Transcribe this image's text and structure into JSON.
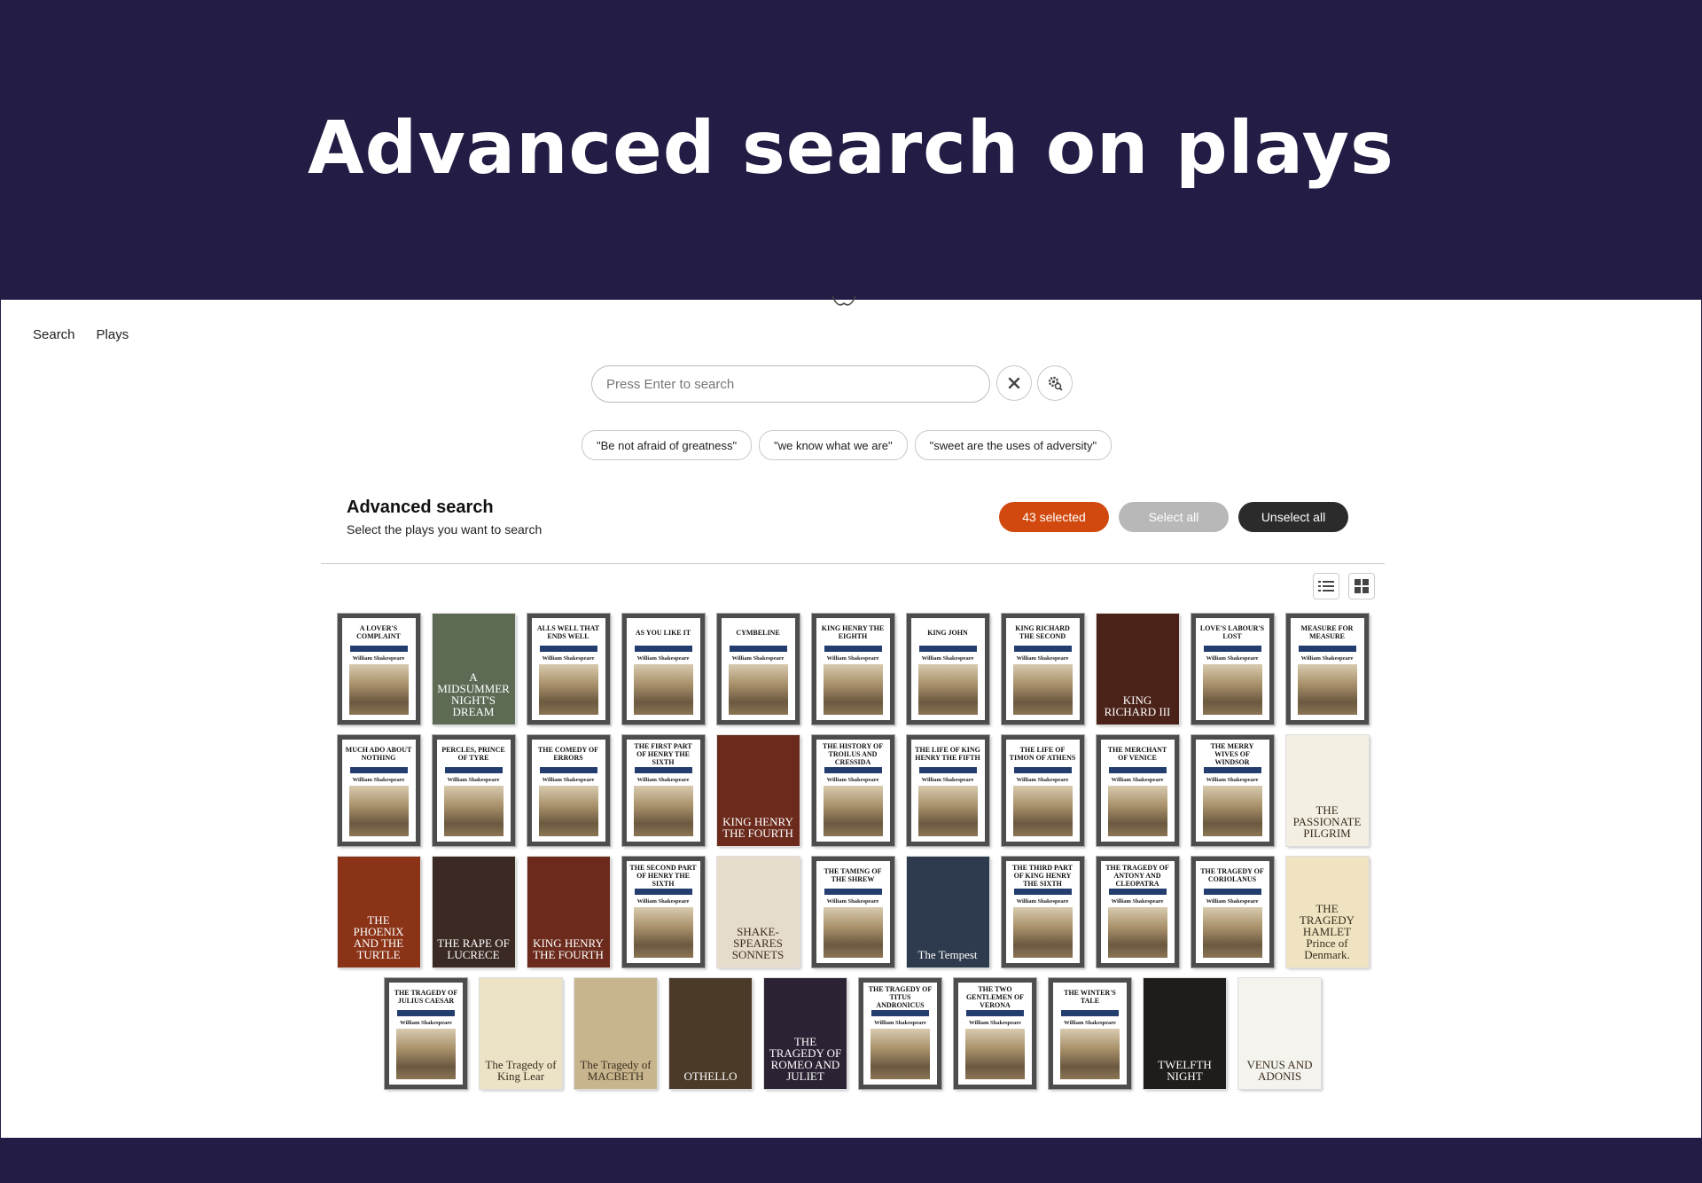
{
  "hero": {
    "title": "Advanced search on plays"
  },
  "nav": {
    "items": [
      "Search",
      "Plays"
    ]
  },
  "search": {
    "placeholder": "Press Enter to search",
    "value": ""
  },
  "suggestions": [
    "\"Be not afraid of greatness\"",
    "\"we know what we are\"",
    "\"sweet are the uses of adversity\""
  ],
  "advanced": {
    "title": "Advanced search",
    "subtitle": "Select the plays you want to search",
    "selected_label": "43 selected",
    "select_all_label": "Select all",
    "unselect_all_label": "Unselect all"
  },
  "colors": {
    "header_bg": "#231d45",
    "accent": "#d2490f",
    "dark_button": "#2b2b2b",
    "disabled_button": "#b8b8b8"
  },
  "icons": [
    "close-icon",
    "search-settings-icon",
    "list-view-icon",
    "grid-view-icon"
  ],
  "books": [
    {
      "title": "A LOVER'S COMPLAINT",
      "style": "classic"
    },
    {
      "title": "A MIDSUMMER NIGHT'S DREAM",
      "style": "art",
      "bg": "#5d6b55"
    },
    {
      "title": "ALLS WELL THAT ENDS WELL",
      "style": "classic"
    },
    {
      "title": "AS YOU LIKE IT",
      "style": "classic"
    },
    {
      "title": "CYMBELINE",
      "style": "classic"
    },
    {
      "title": "KING HENRY THE EIGHTH",
      "style": "classic"
    },
    {
      "title": "KING JOHN",
      "style": "classic"
    },
    {
      "title": "KING RICHARD THE SECOND",
      "style": "classic"
    },
    {
      "title": "KING RICHARD III",
      "style": "art",
      "bg": "#4a2218"
    },
    {
      "title": "LOVE'S LABOUR'S LOST",
      "style": "classic"
    },
    {
      "title": "MEASURE FOR MEASURE",
      "style": "classic"
    },
    {
      "title": "MUCH ADO ABOUT NOTHING",
      "style": "classic"
    },
    {
      "title": "PERCLES, PRINCE OF TYRE",
      "style": "classic"
    },
    {
      "title": "THE COMEDY OF ERRORS",
      "style": "classic"
    },
    {
      "title": "THE FIRST PART OF HENRY THE SIXTH",
      "style": "classic"
    },
    {
      "title": "KING HENRY THE FOURTH",
      "style": "art",
      "bg": "#6b2a1c"
    },
    {
      "title": "THE HISTORY OF TROILUS AND CRESSIDA",
      "style": "classic"
    },
    {
      "title": "THE LIFE OF KING HENRY THE FIFTH",
      "style": "classic"
    },
    {
      "title": "THE LIFE OF TIMON OF ATHENS",
      "style": "classic"
    },
    {
      "title": "THE MERCHANT OF VENICE",
      "style": "classic"
    },
    {
      "title": "THE MERRY WIVES OF WINDSOR",
      "style": "classic"
    },
    {
      "title": "THE PASSIONATE PILGRIM",
      "style": "art",
      "bg": "#f4efe3",
      "dark": true
    },
    {
      "title": "THE PHOENIX AND THE TURTLE",
      "style": "art",
      "bg": "#8a3317"
    },
    {
      "title": "THE RAPE OF LUCRECE",
      "style": "art",
      "bg": "#3b2a24"
    },
    {
      "title": "KING HENRY THE FOURTH",
      "style": "art",
      "bg": "#6b2a1c"
    },
    {
      "title": "THE SECOND PART OF HENRY THE SIXTH",
      "style": "classic"
    },
    {
      "title": "SHAKE-SPEARES SONNETS",
      "style": "art",
      "bg": "#e6dccb",
      "dark": true
    },
    {
      "title": "THE TAMING OF THE SHREW",
      "style": "classic"
    },
    {
      "title": "The Tempest",
      "style": "art",
      "bg": "#2e3b4e"
    },
    {
      "title": "THE THIRD PART OF KING HENRY THE SIXTH",
      "style": "classic"
    },
    {
      "title": "THE TRAGEDY OF ANTONY AND CLEOPATRA",
      "style": "classic"
    },
    {
      "title": "THE TRAGEDY OF CORIOLANUS",
      "style": "classic"
    },
    {
      "title": "THE TRAGEDY HAMLET Prince of Denmark.",
      "style": "art",
      "bg": "#efe3c2",
      "dark": true
    },
    {
      "title": "THE TRAGEDY OF JULIUS CAESAR",
      "style": "classic"
    },
    {
      "title": "The Tragedy of King Lear",
      "style": "art",
      "bg": "#ece2c6",
      "dark": true
    },
    {
      "title": "The Tragedy of MACBETH",
      "style": "art",
      "bg": "#c9b58d",
      "dark": true
    },
    {
      "title": "OTHELLO",
      "style": "art",
      "bg": "#4b3a28"
    },
    {
      "title": "THE TRAGEDY OF ROMEO AND JULIET",
      "style": "art",
      "bg": "#2b2233"
    },
    {
      "title": "THE TRAGEDY OF TITUS ANDRONICUS",
      "style": "classic"
    },
    {
      "title": "THE TWO GENTLEMEN OF VERONA",
      "style": "classic"
    },
    {
      "title": "THE WINTER'S TALE",
      "style": "classic"
    },
    {
      "title": "TWELFTH NIGHT",
      "style": "art",
      "bg": "#1f1d1a"
    },
    {
      "title": "VENUS AND ADONIS",
      "style": "art",
      "bg": "#f5f3ee",
      "dark": true
    }
  ],
  "classic_series": {
    "author": "William Shakespeare"
  }
}
